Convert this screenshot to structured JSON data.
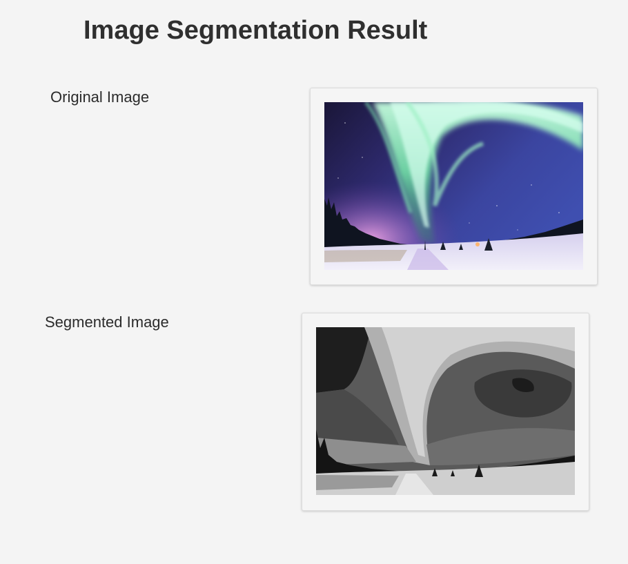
{
  "page": {
    "title": "Image Segmentation Result"
  },
  "sections": {
    "original": {
      "label": "Original Image",
      "image": "aurora-photo"
    },
    "segmented": {
      "label": "Segmented Image",
      "image": "aurora-segmented-grayscale"
    }
  },
  "colors": {
    "background": "#f4f4f4",
    "text": "#2b2b2b",
    "card_border": "#dcdcdc",
    "sky_dark": "#1d1a4a",
    "aurora_green": "#a8f0c8",
    "horizon_pink": "#d88ad8",
    "snow": "#e8e6f4"
  }
}
